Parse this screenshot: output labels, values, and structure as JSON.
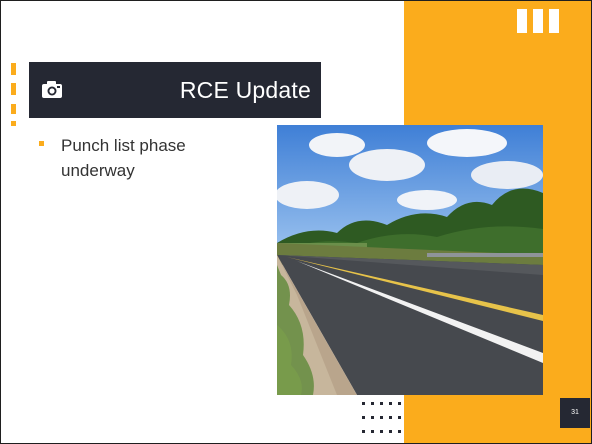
{
  "slide": {
    "title": "RCE Update",
    "bullets": [
      "Punch list phase underway"
    ],
    "page_number": "31"
  },
  "colors": {
    "accent": "#fbac1c",
    "dark": "#252833",
    "text": "#333333",
    "background": "#ffffff"
  },
  "icons": {
    "title_icon": "camera-icon"
  },
  "photo": {
    "subject": "road-construction-photo"
  }
}
